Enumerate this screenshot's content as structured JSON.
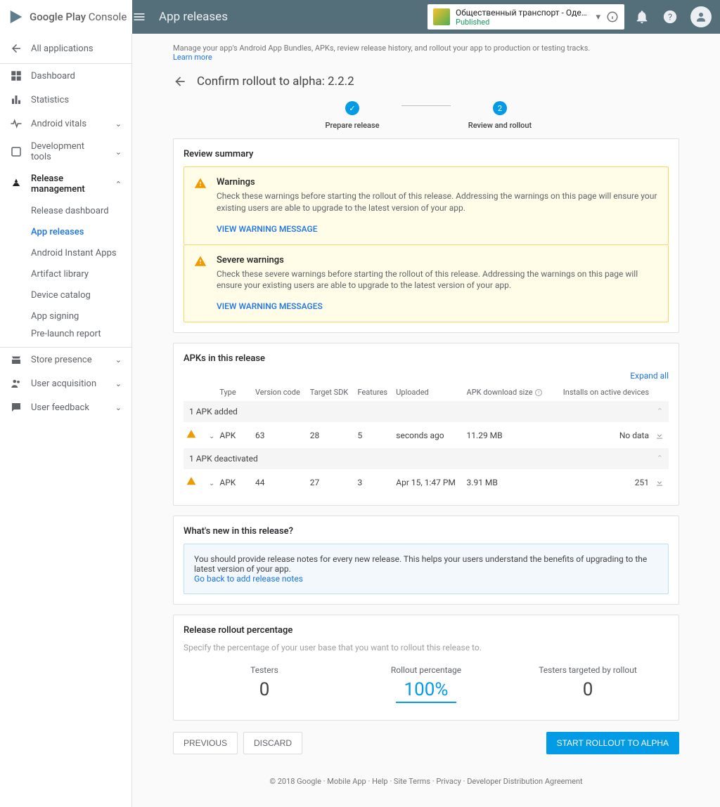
{
  "logo": "Google Play Console",
  "topbar_title": "App releases",
  "app": {
    "name": "Общественный транспорт - Одесса",
    "status": "Published"
  },
  "intro_text": "Manage your app's Android App Bundles, APKs, review release history, and rollout your app to production or testing tracks.",
  "learn_more": "Learn more",
  "page_title": "Confirm rollout to alpha: 2.2.2",
  "stepper": {
    "step1": "Prepare release",
    "step2": "Review and rollout"
  },
  "sidebar": {
    "all_apps": "All applications",
    "dashboard": "Dashboard",
    "statistics": "Statistics",
    "vitals": "Android vitals",
    "dev_tools": "Development tools",
    "release_mgmt": "Release management",
    "release_dash": "Release dashboard",
    "app_releases": "App releases",
    "instant": "Android Instant Apps",
    "artifact": "Artifact library",
    "device_catalog": "Device catalog",
    "app_signing": "App signing",
    "prelaunch": "Pre-launch report",
    "store": "Store presence",
    "user_acq": "User acquisition",
    "user_fb": "User feedback"
  },
  "review": {
    "heading": "Review summary",
    "warn1_title": "Warnings",
    "warn1_body": "Check these warnings before starting the rollout of this release. Addressing the warnings on this page will ensure your existing users are able to upgrade to the latest version of your app.",
    "warn1_link": "VIEW WARNING MESSAGE",
    "warn2_title": "Severe warnings",
    "warn2_body": "Check these severe warnings before starting the rollout of this release. Addressing the warnings on this page will ensure your existing users are able to upgrade to the latest version of your app.",
    "warn2_link": "VIEW WARNING MESSAGES"
  },
  "apks": {
    "heading": "APKs in this release",
    "expand_all": "Expand all",
    "cols": {
      "type": "Type",
      "vc": "Version code",
      "sdk": "Target SDK",
      "feat": "Features",
      "up": "Uploaded",
      "size": "APK download size",
      "inst": "Installs on active devices"
    },
    "group1": "1 APK added",
    "group2": "1 APK deactivated",
    "row1": {
      "type": "APK",
      "vc": "63",
      "sdk": "28",
      "feat": "5",
      "up": "seconds ago",
      "size": "11.29 MB",
      "inst": "No data"
    },
    "row2": {
      "type": "APK",
      "vc": "44",
      "sdk": "27",
      "feat": "3",
      "up": "Apr 15, 1:47 PM",
      "size": "3.91 MB",
      "inst": "251"
    }
  },
  "whatsnew": {
    "heading": "What's new in this release?",
    "body": "You should provide release notes for every new release. This helps your users understand the benefits of upgrading to the latest version of your app.",
    "link": "Go back to add release notes"
  },
  "rollout": {
    "heading": "Release rollout percentage",
    "sub": "Specify the percentage of your user base that you want to rollout this release to.",
    "testers_label": "Testers",
    "testers_val": "0",
    "pct_label": "Rollout percentage",
    "pct_val": "100%",
    "targeted_label": "Testers targeted by rollout",
    "targeted_val": "0"
  },
  "buttons": {
    "prev": "PREVIOUS",
    "discard": "DISCARD",
    "start": "START ROLLOUT TO ALPHA"
  },
  "footer": "© 2018 Google · Mobile App · Help · Site Terms · Privacy · Developer Distribution Agreement"
}
